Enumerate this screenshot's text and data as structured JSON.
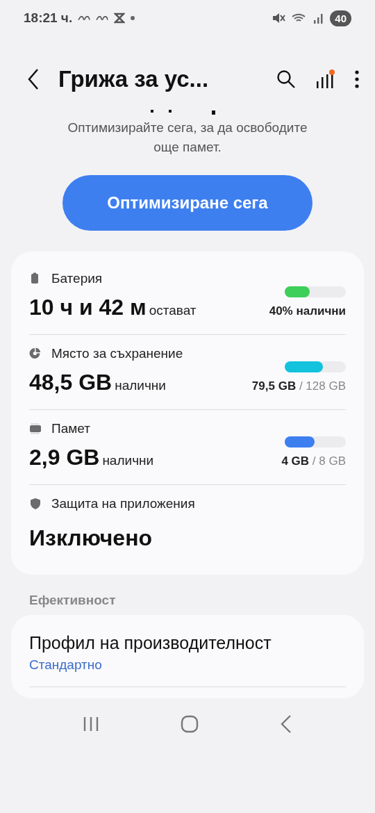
{
  "status_bar": {
    "time": "18:21 ч.",
    "battery": "40"
  },
  "header": {
    "title": "Грижа за ус...",
    "has_update": true
  },
  "intro": {
    "text": "Оптимизирайте сега, за да освободите още памет.",
    "button": "Оптимизиране сега"
  },
  "items": [
    {
      "kind": "meter",
      "label": "Батерия",
      "value": "10 ч и 42 м",
      "unit": "остават",
      "level": 0.41,
      "color": "#3ecf5a",
      "reading": "**40% налични**"
    },
    {
      "kind": "meter",
      "label": "Място за съхранение",
      "value": "48,5 GB",
      "unit": "налични",
      "level": 0.62,
      "color": "#13c2dc",
      "reading": "**79,5 GB** / 128 GB"
    },
    {
      "kind": "meter",
      "label": "Памет",
      "value": "2,9 GB",
      "unit": "налични",
      "level": 0.49,
      "color": "#3e7ff0",
      "reading": "**4 GB** / 8 GB"
    },
    {
      "kind": "status",
      "label": "Защита на приложения",
      "value": "Изключено"
    }
  ],
  "section": {
    "title": "Ефективност"
  },
  "settings": [
    {
      "title": "Профил на производителност",
      "value": "Стандартно"
    }
  ]
}
